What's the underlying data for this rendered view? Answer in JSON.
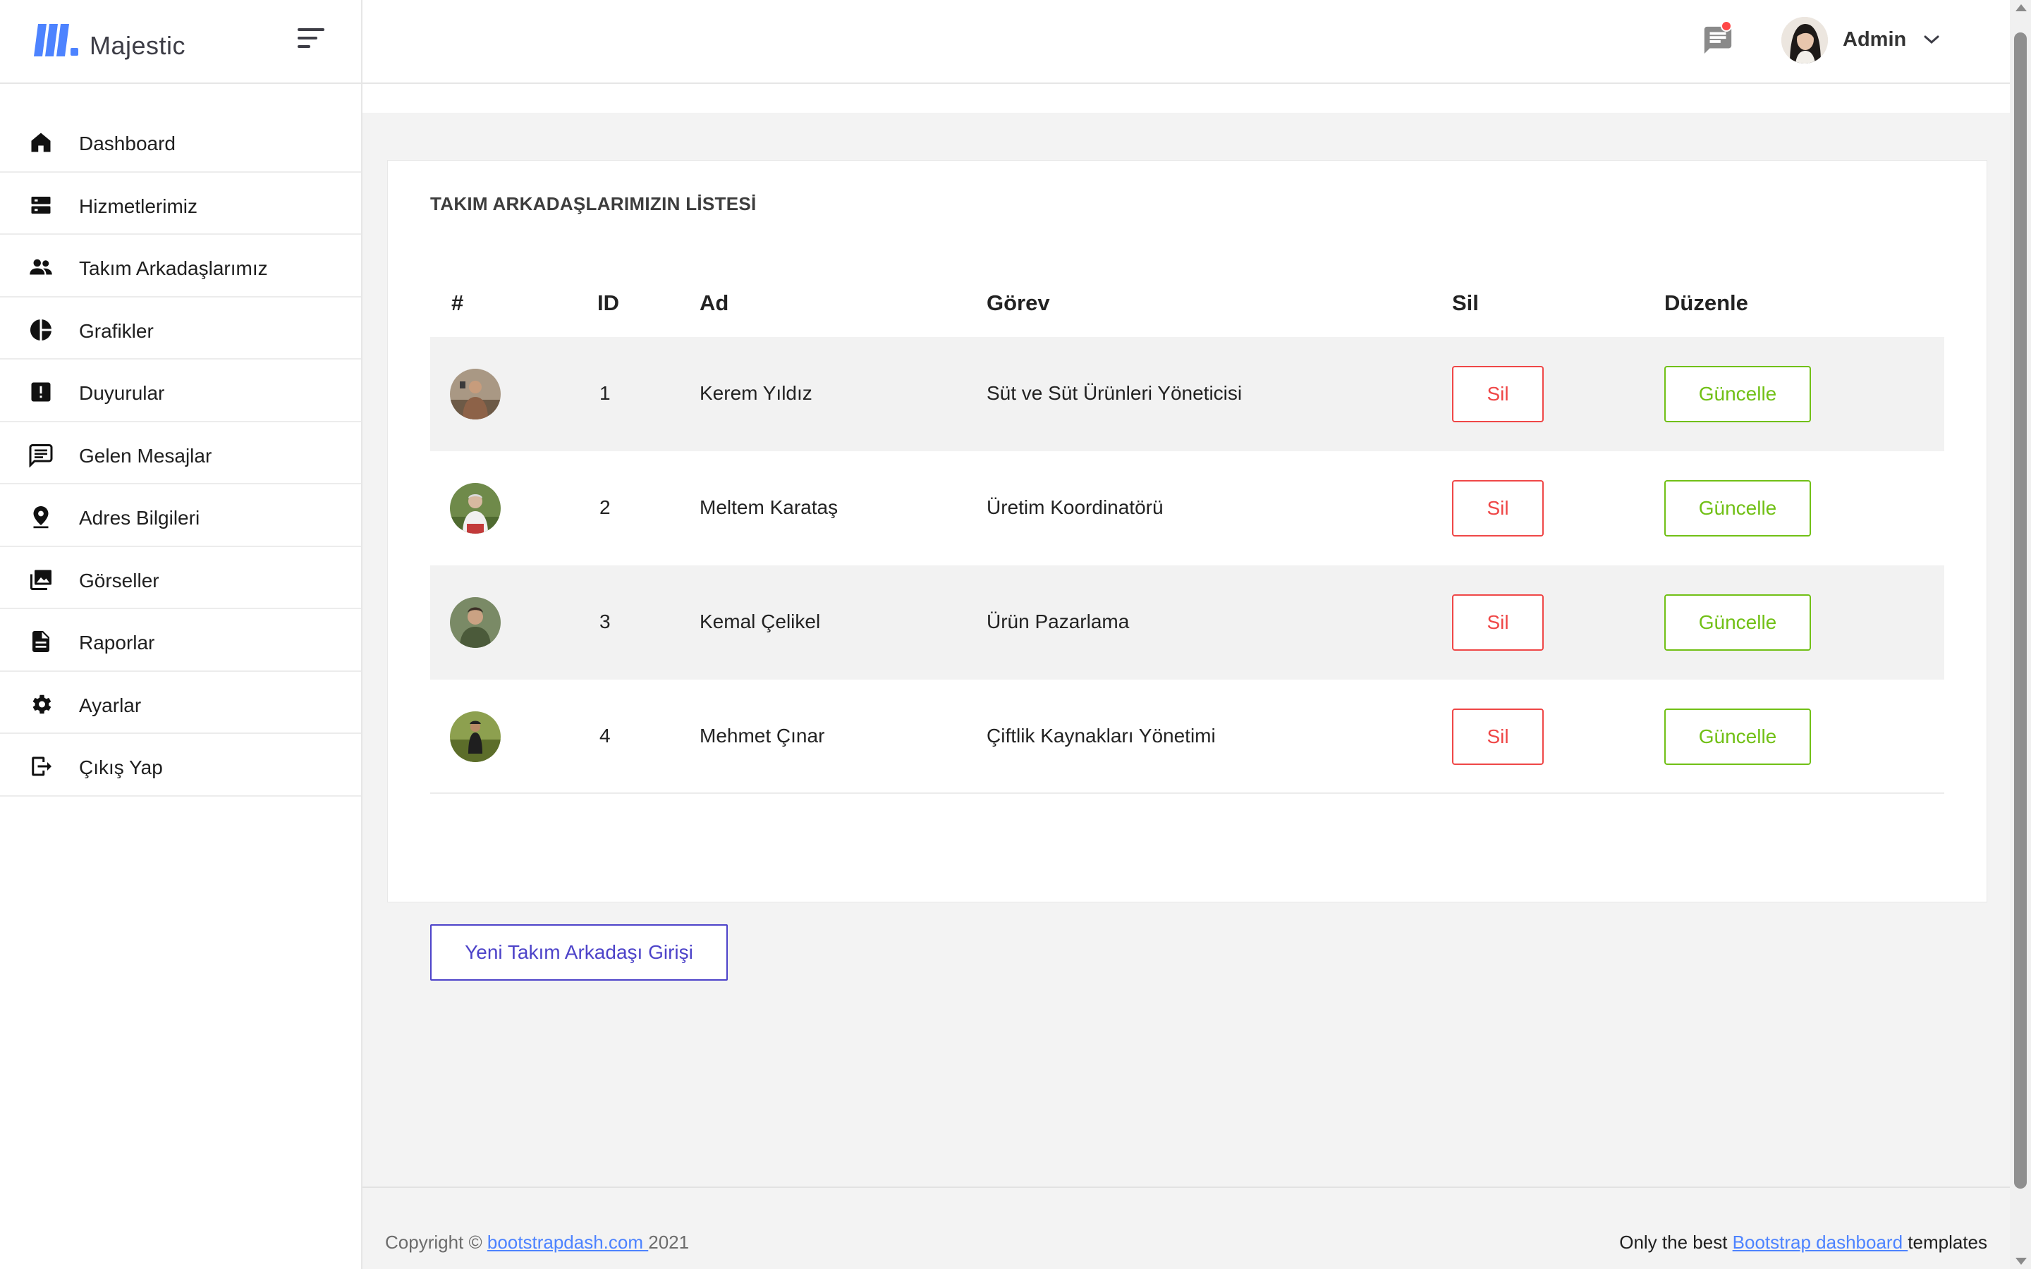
{
  "brand": {
    "name": "Majestic",
    "logo_color": "#4d83ff"
  },
  "header": {
    "messages_icon": "message-icon",
    "notification_dot_color": "#ff4747",
    "profile_name": "Admin",
    "profile_caret": "chevron-down-icon"
  },
  "sidebar": {
    "items": [
      {
        "label": "Dashboard",
        "icon": "home-icon"
      },
      {
        "label": "Hizmetlerimiz",
        "icon": "server-icon"
      },
      {
        "label": "Takım Arkadaşlarımız",
        "icon": "people-icon"
      },
      {
        "label": "Grafikler",
        "icon": "pie-chart-icon"
      },
      {
        "label": "Duyurular",
        "icon": "alert-icon"
      },
      {
        "label": "Gelen Mesajlar",
        "icon": "message-icon"
      },
      {
        "label": "Adres Bilgileri",
        "icon": "location-pin-icon"
      },
      {
        "label": "Görseller",
        "icon": "images-icon"
      },
      {
        "label": "Raporlar",
        "icon": "document-icon"
      },
      {
        "label": "Ayarlar",
        "icon": "gear-icon"
      },
      {
        "label": "Çıkış Yap",
        "icon": "logout-icon"
      }
    ]
  },
  "main": {
    "card_title": "TAKIM ARKADAŞLARIMIZIN LİSTESİ",
    "table": {
      "headers": {
        "hash": "#",
        "id": "ID",
        "name": "Ad",
        "role": "Görev",
        "delete": "Sil",
        "edit": "Düzenle"
      },
      "rows": [
        {
          "id": "1",
          "name": "Kerem Yıldız",
          "role": "Süt ve Süt Ürünleri Yöneticisi",
          "delete_label": "Sil",
          "edit_label": "Güncelle"
        },
        {
          "id": "2",
          "name": "Meltem Karataş",
          "role": "Üretim Koordinatörü",
          "delete_label": "Sil",
          "edit_label": "Güncelle"
        },
        {
          "id": "3",
          "name": "Kemal Çelikel",
          "role": "Ürün Pazarlama",
          "delete_label": "Sil",
          "edit_label": "Güncelle"
        },
        {
          "id": "4",
          "name": "Mehmet Çınar",
          "role": "Çiftlik Kaynakları Yönetimi",
          "delete_label": "Sil",
          "edit_label": "Güncelle"
        }
      ]
    },
    "new_button_label": "Yeni Takım Arkadaşı Girişi",
    "colors": {
      "delete": "#ef4747",
      "edit": "#71c016",
      "primary": "#4d43c9"
    }
  },
  "footer": {
    "copyright_prefix": "Copyright © ",
    "copyright_link": "bootstrapdash.com ",
    "copyright_year": "2021",
    "right_prefix": "Only the best ",
    "right_link": "Bootstrap dashboard ",
    "right_suffix": "templates"
  }
}
